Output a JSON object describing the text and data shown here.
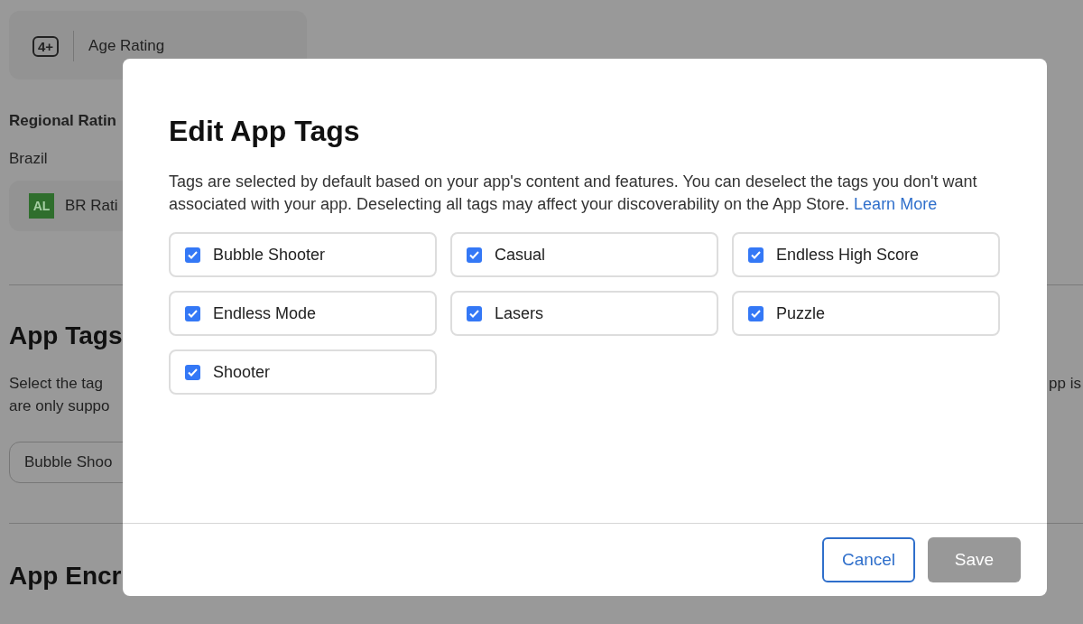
{
  "background": {
    "age_badge": "4+",
    "age_label": "Age Rating",
    "regional_heading": "Regional Ratin",
    "country": "Brazil",
    "rating_icon": "AL",
    "rating_label": "BR Rati",
    "section_heading": "App Tags",
    "section_text_lines": [
      "Select the tag",
      "are only suppo"
    ],
    "section_text_right": "pp is",
    "tag_chip": "Bubble Shoo",
    "next_heading": "App Encr"
  },
  "dialog": {
    "title": "Edit App Tags",
    "description": "Tags are selected by default based on your app's content and features. You can deselect the tags you don't want associated with your app. Deselecting all tags may affect your discoverability on the App Store.",
    "link": "Learn More",
    "tags": [
      {
        "label": "Bubble Shooter",
        "checked": true
      },
      {
        "label": "Casual",
        "checked": true
      },
      {
        "label": "Endless High Score",
        "checked": true
      },
      {
        "label": "Endless Mode",
        "checked": true
      },
      {
        "label": "Lasers",
        "checked": true
      },
      {
        "label": "Puzzle",
        "checked": true
      },
      {
        "label": "Shooter",
        "checked": true
      }
    ],
    "buttons": [
      {
        "label": "Cancel",
        "disabled": false
      },
      {
        "label": "Save",
        "disabled": true
      }
    ]
  }
}
